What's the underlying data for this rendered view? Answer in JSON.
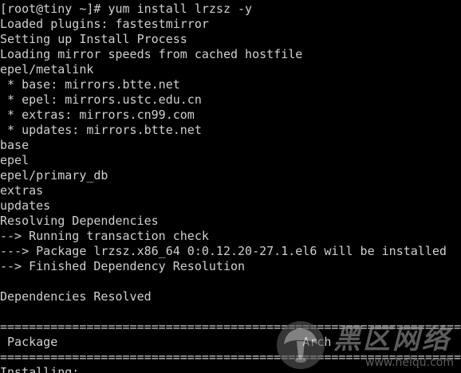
{
  "terminal": {
    "prompt": "[root@tiny ~]# ",
    "command": "yum install lrzsz -y",
    "output": [
      "Loaded plugins: fastestmirror",
      "Setting up Install Process",
      "Loading mirror speeds from cached hostfile",
      "epel/metalink",
      " * base: mirrors.btte.net",
      " * epel: mirrors.ustc.edu.cn",
      " * extras: mirrors.cn99.com",
      " * updates: mirrors.btte.net",
      "base",
      "epel",
      "epel/primary_db",
      "extras",
      "updates",
      "Resolving Dependencies",
      "--> Running transaction check",
      "---> Package lrzsz.x86_64 0:0.12.20-27.1.el6 will be installed",
      "--> Finished Dependency Resolution",
      "",
      "Dependencies Resolved",
      "",
      "================================================================",
      " Package                                  Arch",
      "================================================================",
      "Installing:"
    ],
    "colors": {
      "background": "#000000",
      "foreground": "#d0d0d0"
    }
  },
  "watermark": {
    "title": "黑区网络",
    "url": "www.heiqu.com"
  }
}
